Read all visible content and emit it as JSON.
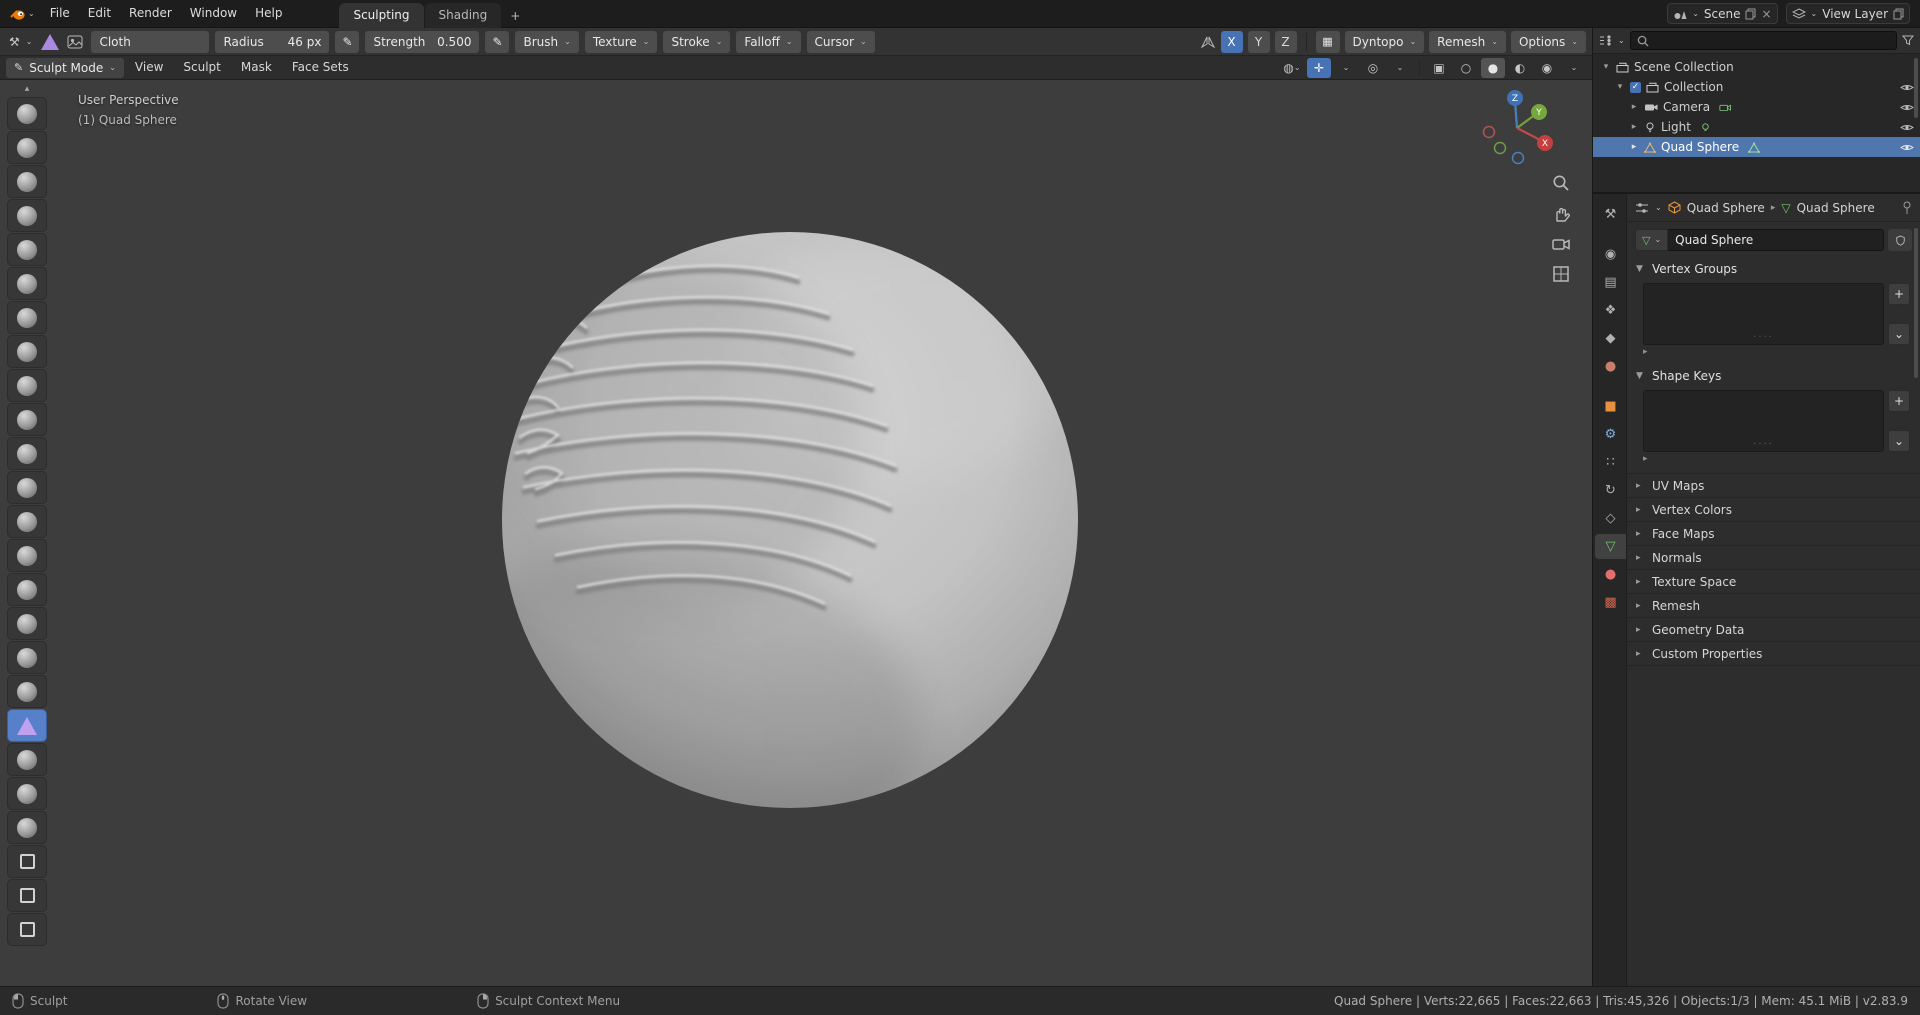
{
  "topbar": {
    "menus": [
      "File",
      "Edit",
      "Render",
      "Window",
      "Help"
    ],
    "workspace_tabs": [
      "Sculpting",
      "Shading"
    ],
    "new_tab_label": "+",
    "scene_name": "Scene",
    "view_layer_name": "View Layer"
  },
  "tool_settings": {
    "brush_name": "Cloth",
    "radius_label": "Radius",
    "radius_value": "46 px",
    "strength_label": "Strength",
    "strength_value": "0.500",
    "dropdowns": [
      "Brush",
      "Texture",
      "Stroke",
      "Falloff",
      "Cursor"
    ],
    "mirror_x": "X",
    "mirror_y": "Y",
    "mirror_z": "Z",
    "dyntopo_label": "Dyntopo",
    "remesh_label": "Remesh",
    "options_label": "Options"
  },
  "viewport_header": {
    "mode": "Sculpt Mode",
    "menus": [
      "View",
      "Sculpt",
      "Mask",
      "Face Sets"
    ]
  },
  "viewport": {
    "perspective_label": "User Perspective",
    "object_label": "(1) Quad Sphere",
    "axis_x": "X",
    "axis_y": "Y",
    "axis_z": "Z"
  },
  "left_toolbar": {
    "brushes": [
      {
        "name": "layer"
      },
      {
        "name": "inflate"
      },
      {
        "name": "blob"
      },
      {
        "name": "crease"
      },
      {
        "name": "smooth"
      },
      {
        "name": "flatten"
      },
      {
        "name": "fill"
      },
      {
        "name": "scrape"
      },
      {
        "name": "multi-plane-scrape"
      },
      {
        "name": "pinch"
      },
      {
        "name": "grab"
      },
      {
        "name": "elastic-deform"
      },
      {
        "name": "snake-hook"
      },
      {
        "name": "thumb"
      },
      {
        "name": "pose"
      },
      {
        "name": "nudge"
      },
      {
        "name": "rotate"
      },
      {
        "name": "slide-relax"
      },
      {
        "name": "cloth",
        "active": true
      },
      {
        "name": "simplify"
      },
      {
        "name": "mask"
      },
      {
        "name": "draw-face-sets"
      },
      {
        "name": "box-mask",
        "style": "square"
      },
      {
        "name": "box-hide",
        "style": "square"
      },
      {
        "name": "mesh-filter",
        "style": "square"
      }
    ]
  },
  "outliner": {
    "rows": [
      {
        "label": "Scene Collection"
      },
      {
        "label": "Collection"
      },
      {
        "label": "Camera"
      },
      {
        "label": "Light"
      },
      {
        "label": "Quad Sphere"
      }
    ]
  },
  "properties": {
    "breadcrumb_object": "Quad Sphere",
    "breadcrumb_data": "Quad Sphere",
    "name_field": "Quad Sphere",
    "vertex_groups_label": "Vertex Groups",
    "shape_keys_label": "Shape Keys",
    "add_button": "+",
    "specials_button": "⌄",
    "collapsed_panels": [
      "UV Maps",
      "Vertex Colors",
      "Face Maps",
      "Normals",
      "Texture Space",
      "Remesh",
      "Geometry Data",
      "Custom Properties"
    ],
    "tabs": [
      {
        "name": "tool",
        "glyph": "⚒",
        "color": "#b0b0b0"
      },
      {
        "name": "render",
        "glyph": "◉",
        "color": "#b0b0b0",
        "gap": true
      },
      {
        "name": "output",
        "glyph": "▤",
        "color": "#b0b0b0"
      },
      {
        "name": "view-layer",
        "glyph": "❖",
        "color": "#b0b0b0"
      },
      {
        "name": "scene",
        "glyph": "◆",
        "color": "#b0b0b0"
      },
      {
        "name": "world",
        "glyph": "●",
        "color": "#c87e6e"
      },
      {
        "name": "object",
        "glyph": "■",
        "color": "#e8913c",
        "gap": true
      },
      {
        "name": "modifiers",
        "glyph": "⚙",
        "color": "#84aede"
      },
      {
        "name": "particles",
        "glyph": "∷",
        "color": "#b0b0b0"
      },
      {
        "name": "physics",
        "glyph": "↻",
        "color": "#b0b0b0"
      },
      {
        "name": "constraints",
        "glyph": "◇",
        "color": "#b0b0b0"
      },
      {
        "name": "object-data",
        "glyph": "▽",
        "color": "#71c56e",
        "active": true
      },
      {
        "name": "material",
        "glyph": "●",
        "color": "#e26f6f"
      },
      {
        "name": "texture",
        "glyph": "▩",
        "color": "#d2654e"
      }
    ]
  },
  "status_bar": {
    "hints": [
      {
        "label": "Sculpt"
      },
      {
        "label": "Rotate View"
      },
      {
        "label": "Sculpt Context Menu"
      }
    ],
    "stats": "Quad Sphere | Verts:22,665 | Faces:22,663 | Tris:45,326 | Objects:1/3 | Mem: 45.1 MiB | v2.83.9"
  }
}
